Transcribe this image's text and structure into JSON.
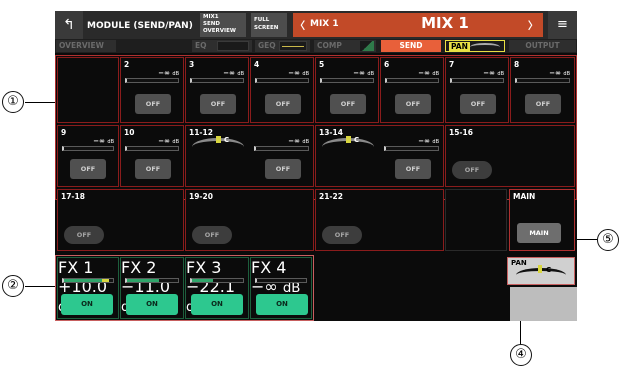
{
  "header": {
    "back_label": "↰",
    "title": "MODULE (SEND/PAN)",
    "send_overview_label": "MIX1 SEND OVERVIEW",
    "full_screen_label": "FULL SCREEN",
    "prev_label": "〈",
    "mix_label_small": "MIX 1",
    "mix_label_large": "MIX 1",
    "next_label": "〉",
    "menu_label": "≡"
  },
  "tabs": {
    "overview": "OVERVIEW",
    "eq": "EQ",
    "geq": "GEQ",
    "comp": "COMP",
    "send": "SEND",
    "pan": "PAN",
    "output": "OUTPUT"
  },
  "unit": "dB",
  "channels": [
    {
      "name": "2",
      "level": "−∞",
      "button": "OFF"
    },
    {
      "name": "3",
      "level": "−∞",
      "button": "OFF"
    },
    {
      "name": "4",
      "level": "−∞",
      "button": "OFF"
    },
    {
      "name": "5",
      "level": "−∞",
      "button": "OFF"
    },
    {
      "name": "6",
      "level": "−∞",
      "button": "OFF"
    },
    {
      "name": "7",
      "level": "−∞",
      "button": "OFF"
    },
    {
      "name": "8",
      "level": "−∞",
      "button": "OFF"
    },
    {
      "name": "9",
      "level": "−∞",
      "button": "OFF"
    },
    {
      "name": "10",
      "level": "−∞",
      "button": "OFF"
    },
    {
      "name": "11-12",
      "level": "−∞",
      "button": "OFF",
      "pan": "C"
    },
    {
      "name": "13-14",
      "level": "−∞",
      "button": "OFF",
      "pan": "C"
    },
    {
      "name": "15-16",
      "button": "OFF"
    },
    {
      "name": "17-18",
      "button": "OFF"
    },
    {
      "name": "19-20",
      "button": "OFF"
    },
    {
      "name": "21-22",
      "button": "OFF"
    }
  ],
  "main": {
    "name": "MAIN",
    "button": "MAIN"
  },
  "fx": [
    {
      "name": "FX 1",
      "level": "+10.0",
      "button": "ON",
      "fill": 0.92
    },
    {
      "name": "FX 2",
      "level": "−11.0",
      "button": "ON",
      "fill": 0.62
    },
    {
      "name": "FX 3",
      "level": "−22.1",
      "button": "ON",
      "fill": 0.42
    },
    {
      "name": "FX 4",
      "level": "−∞",
      "button": "ON",
      "fill": 0.0
    }
  ],
  "pan_box": {
    "label": "PAN",
    "value": "C"
  },
  "callouts": [
    "①",
    "②",
    "④",
    "⑤"
  ],
  "colors": {
    "accent_red": "#8a1c1c",
    "send_tab": "#e8603a",
    "pan_tab": "#e8e044",
    "on_button": "#2dc88f",
    "mix_bar": "#c24a28"
  }
}
